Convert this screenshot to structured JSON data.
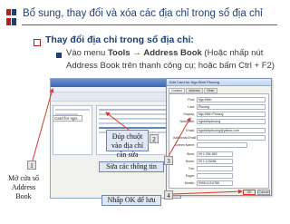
{
  "header": {
    "title": "Bổ sung, thay đổi và xóa các địa chỉ trong sổ địa chỉ"
  },
  "bullets": {
    "level1": "Thay đổi địa chỉ trong sổ địa chỉ:",
    "level2_prefix": "Vào menu",
    "level2_tools": "Tools",
    "level2_arrow": "→",
    "level2_address_book": "Address Book",
    "level2_rest": "(Hoặc nhấp nút Address Book trên thanh công cụ; hoặc bấm Ctrl + F2)"
  },
  "address_book_window": {
    "card_label": "Card for ngo..."
  },
  "dialog": {
    "title": "Edit Card for Ngo Binh Phuong",
    "tabs": [
      "Contact",
      "Address",
      "Other"
    ],
    "fields": [
      {
        "label": "First:",
        "value": "Ngo Binh"
      },
      {
        "label": "Last:",
        "value": "Phuong"
      },
      {
        "label": "Display:",
        "value": "Ngo Binh Phuong"
      },
      {
        "label": "Nickname:",
        "value": "ngobinhphuong"
      },
      {
        "label": "Email:",
        "value": "ngobinhphuong@yahoo.com"
      },
      {
        "label": "Additional Email:",
        "value": ""
      },
      {
        "label": "Screen Name:",
        "value": ""
      },
      {
        "label": "Work:",
        "value": "09.1.254.963"
      },
      {
        "label": "Home:",
        "value": "09.1.123456"
      },
      {
        "label": "Fax:",
        "value": ""
      },
      {
        "label": "Pager:",
        "value": ""
      },
      {
        "label": "Mobile:",
        "value": "0906.113.6789"
      }
    ],
    "ok_label": "OK",
    "cancel_label": "Cancel"
  },
  "callouts": {
    "c1": "Mở cửa sổ Address Book",
    "c2": "Đúp chuột vào địa chỉ cần sửa",
    "c3": "Sửa các thông tin",
    "c4": "Nhấp OK để lưu"
  },
  "badges": [
    "1",
    "2",
    "3",
    "4"
  ],
  "colors": {
    "title": "#1f3f73",
    "rule": "#2e6db4",
    "callout_bg": "#dfe6f4",
    "arrow": "#d9392c"
  },
  "icons": {
    "logo": "logo-icon",
    "bullet1": "hollow-square-bullet-icon",
    "bullet2": "filled-square-bullet-icon"
  }
}
